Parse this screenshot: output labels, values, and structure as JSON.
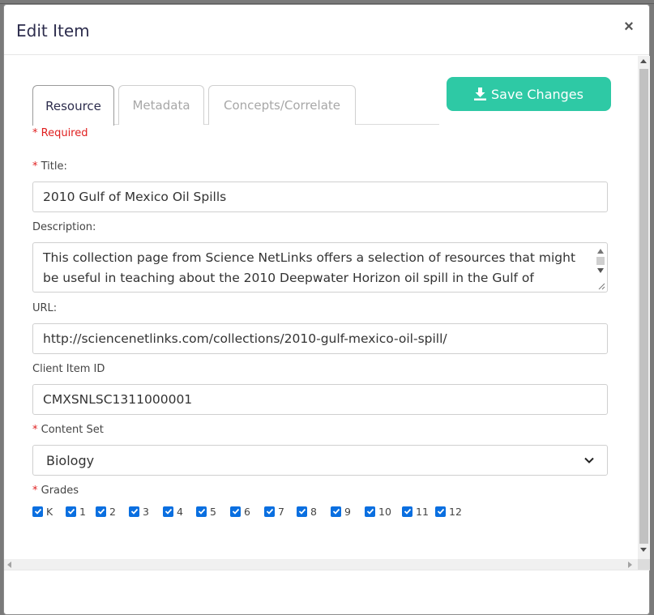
{
  "modal": {
    "title": "Edit Item",
    "close_symbol": "×",
    "close_icon": "close-icon"
  },
  "tabs": [
    {
      "label": "Resource",
      "active": true
    },
    {
      "label": "Metadata",
      "active": false
    },
    {
      "label": "Concepts/Correlate",
      "active": false
    }
  ],
  "save_button": {
    "label": "Save Changes",
    "icon": "download-icon",
    "color": "#2ec9a5"
  },
  "required_note": "* Required",
  "form": {
    "title_label": "Title:",
    "title_value": "2010 Gulf of Mexico Oil Spills",
    "description_label": "Description:",
    "description_value": "This collection page from Science NetLinks offers a selection of resources that might be useful in teaching about the 2010 Deepwater Horizon oil spill in the Gulf of Mexico. It covers what led to the spill and the resulting aftermath.",
    "url_label": "URL:",
    "url_value": "http://sciencenetlinks.com/collections/2010-gulf-mexico-oil-spill/",
    "client_id_label": "Client Item ID",
    "client_id_value": "CMXSNLSC1311000001",
    "content_set_label": "Content Set",
    "content_set_value": "Biology",
    "grades_label": "Grades",
    "required_marker": "*"
  },
  "grades": [
    {
      "label": "K",
      "checked": true
    },
    {
      "label": "1",
      "checked": true
    },
    {
      "label": "2",
      "checked": true
    },
    {
      "label": "3",
      "checked": true
    },
    {
      "label": "4",
      "checked": true
    },
    {
      "label": "5",
      "checked": true
    },
    {
      "label": "6",
      "checked": true
    },
    {
      "label": "7",
      "checked": true
    },
    {
      "label": "8",
      "checked": true
    },
    {
      "label": "9",
      "checked": true
    },
    {
      "label": "10",
      "checked": true
    },
    {
      "label": "11",
      "checked": true
    },
    {
      "label": "12",
      "checked": true
    }
  ],
  "colors": {
    "checkbox": "#0a6fe0",
    "required": "#e02020",
    "title_text": "#2d2d4d"
  }
}
